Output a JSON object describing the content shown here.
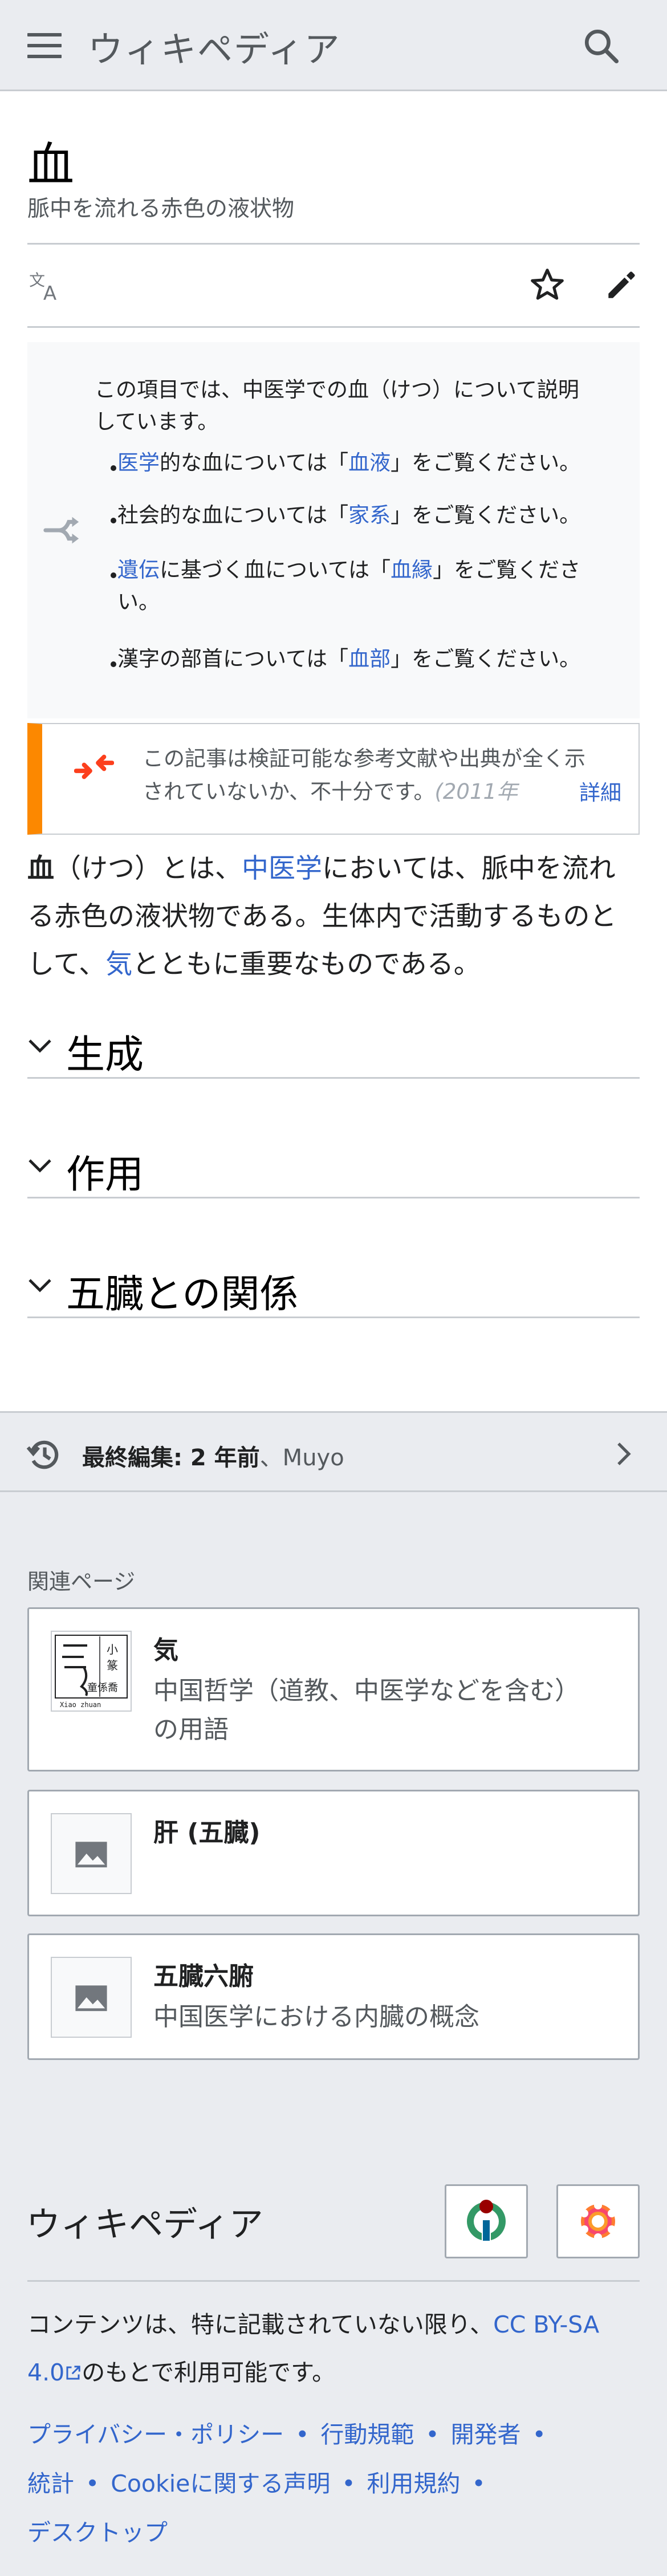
{
  "header": {
    "wordmark": "ウィキペディア"
  },
  "article": {
    "title": "血",
    "subtitle": "脈中を流れる赤色の液状物"
  },
  "hatnote": {
    "intro_line1": "この項目では、中医学での血（けつ）について説明",
    "intro_line2": "しています。",
    "items": [
      {
        "link": "医学",
        "pre": "",
        "mid": "的な血については「",
        "link2": "血液",
        "post": "」をご覧ください。"
      },
      {
        "pre": "社会的な血については「",
        "link2": "家系",
        "post": "」をご覧ください。"
      },
      {
        "link": "遺伝",
        "mid": "に基づく血については「",
        "link2": "血縁",
        "post": "」をご覧くださ",
        "post2": "い。"
      },
      {
        "pre": "漢字の部首については「",
        "link2": "血部",
        "post": "」をご覧ください。"
      }
    ]
  },
  "notice": {
    "line1": "この記事は検証可能な参考文献や出典が全く示",
    "line2": "されていないか、不十分です。",
    "date_fragment": "(2011年",
    "more": "詳細"
  },
  "lead": {
    "bold": "血",
    "t1": "（けつ）とは、",
    "link1": "中医学",
    "t2": "においては、脈中を流れ",
    "t3": "る赤色の液状物である。生体内で活動するものと",
    "t4": "して、",
    "link2": "気",
    "t5": "とともに重要なものである。"
  },
  "sections": [
    {
      "title": "生成"
    },
    {
      "title": "作用"
    },
    {
      "title": "五臓との関係"
    }
  ],
  "last_edit": {
    "label": "最終編集: 2 年前",
    "user": "、Muyo"
  },
  "related": {
    "heading": "関連ページ",
    "cards": [
      {
        "title": "気",
        "desc_line1": "中国哲学（道教、中医学などを含む）",
        "desc_line2": "の用語",
        "thumb_caption": "Xiao zhuan"
      },
      {
        "title": "肝 (五臓)"
      },
      {
        "title": "五臓六腑",
        "desc_line1": "中国医学における内臓の概念"
      }
    ]
  },
  "footer": {
    "wordmark": "ウィキペディア",
    "license_pre": "コンテンツは、特に記載されていない限り、",
    "license_link1": "CC BY-SA",
    "license_link2": "4.0",
    "license_post": "のもとで利用可能です。",
    "links": [
      "プライバシー・ポリシー",
      "行動規範",
      "開発者",
      "統計",
      "Cookieに関する声明",
      "利用規約",
      "デスクトップ"
    ]
  },
  "colors": {
    "link": "#3366cc",
    "notice_accent": "#fc8800",
    "chrome": "#eaecf0"
  },
  "icons": [
    "menu-icon",
    "search-icon",
    "language-icon",
    "star-icon",
    "edit-icon",
    "disambiguation-icon",
    "merge-icon",
    "chevron-down-icon",
    "history-icon",
    "chevron-right-icon",
    "image-icon",
    "wikimedia-icon",
    "mediawiki-icon"
  ]
}
